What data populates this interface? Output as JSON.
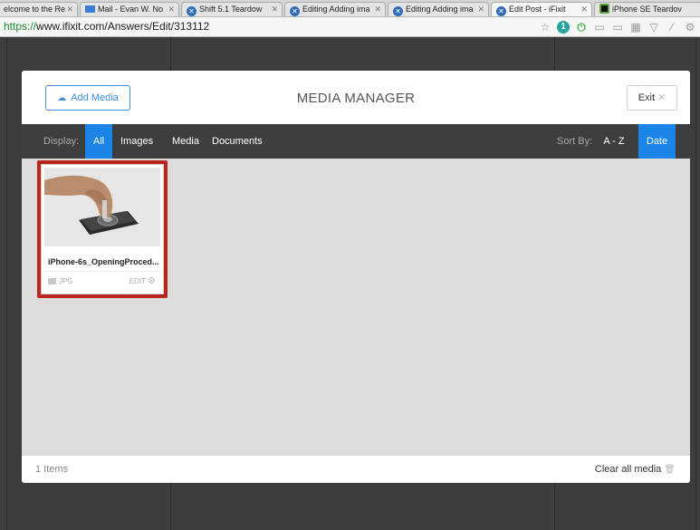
{
  "browser": {
    "tabs": [
      {
        "label": "elcome to the Re",
        "icon": "none"
      },
      {
        "label": "Mail - Evan W. No",
        "icon": "mail-icon"
      },
      {
        "label": "Shift 5.1 Teardow",
        "icon": "ifixit-icon"
      },
      {
        "label": "Editing Adding ima",
        "icon": "ifixit-icon"
      },
      {
        "label": "Editing Adding ima",
        "icon": "ifixit-icon"
      },
      {
        "label": "Edit Post - iFixit",
        "icon": "ifixit-icon"
      },
      {
        "label": "iPhone SE Teardov",
        "icon": "square-icon"
      }
    ],
    "url_scheme": "https://",
    "url_rest": "www.ifixit.com/Answers/Edit/313112"
  },
  "modal": {
    "add_media_label": "Add Media",
    "title": "MEDIA MANAGER",
    "exit_label": "Exit",
    "display_label": "Display:",
    "filters": [
      "All",
      "Images",
      "Media",
      "Documents"
    ],
    "active_filter": "All",
    "sort_label": "Sort By:",
    "sort_options": [
      "A - Z",
      "Date"
    ],
    "active_sort": "Date",
    "items": [
      {
        "filename": "iPhone-6s_OpeningProced...",
        "type": "JPG",
        "edit_label": "EDIT"
      }
    ],
    "item_count": "1 Items",
    "clear_label": "Clear all media"
  },
  "colors": {
    "accent": "#1b84e8",
    "highlight": "#b8261e",
    "filter_bar": "#3c3f42"
  }
}
